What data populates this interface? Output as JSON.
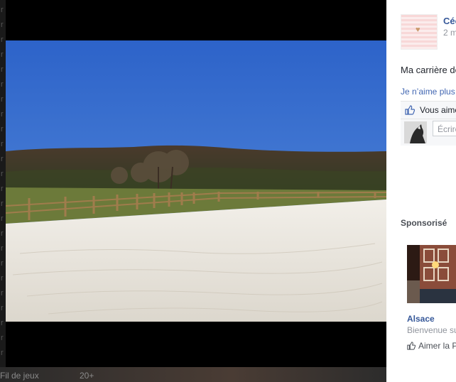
{
  "background": {
    "side_letters": [
      "r",
      "r",
      "r",
      "r",
      "r",
      "r",
      "r",
      "r",
      "r",
      "r",
      "r",
      "r",
      "r",
      "r",
      "r",
      "r",
      "r",
      "r",
      "r",
      "r",
      "r",
      "r",
      "r",
      "r"
    ],
    "list_label": "Fil de jeux",
    "list_count": "20+"
  },
  "post": {
    "author": "Céc",
    "time": "2 m",
    "caption": "Ma carrière de",
    "unlike_link": "Je n’aime plus",
    "likes_text": "Vous aime",
    "comment_placeholder": "Écrire"
  },
  "sponsored": {
    "title": "Sponsorisé",
    "ad_name": "Alsace",
    "ad_desc": "Bienvenue su",
    "ad_like": "Aimer la P"
  },
  "colors": {
    "link": "#365899",
    "action": "#4267b2",
    "sky_top": "#2d63c9",
    "sand": "#e9e6df"
  }
}
